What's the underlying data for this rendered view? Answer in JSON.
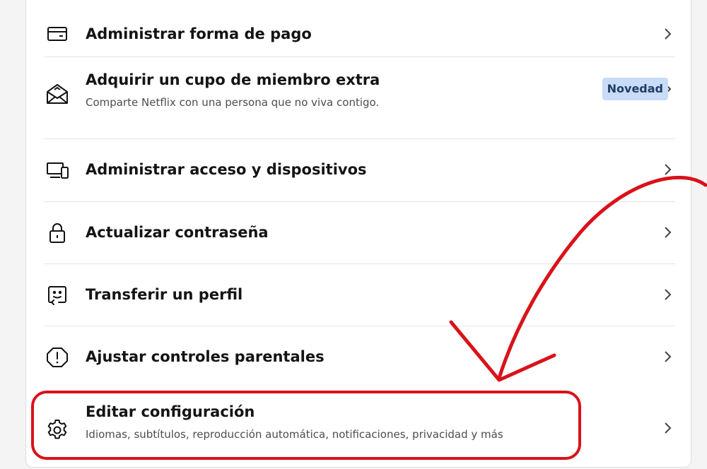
{
  "menu": {
    "payment": {
      "title": "Administrar forma de pago",
      "icon": "credit-card-icon"
    },
    "extra_member": {
      "title": "Adquirir un cupo de miembro extra",
      "subtitle": "Comparte Netflix con una persona que no viva contigo.",
      "badge": "Novedad",
      "icon": "envelope-open-icon"
    },
    "devices": {
      "title": "Administrar acceso y dispositivos",
      "icon": "devices-icon"
    },
    "password": {
      "title": "Actualizar contraseña",
      "icon": "lock-icon"
    },
    "transfer": {
      "title": "Transferir un perfil",
      "icon": "profile-transfer-icon"
    },
    "parental": {
      "title": "Ajustar controles parentales",
      "icon": "shield-alert-icon"
    },
    "settings": {
      "title": "Editar configuración",
      "subtitle": "Idiomas, subtítulos, reproducción automática, notificaciones, privacidad y más",
      "icon": "gear-icon"
    }
  },
  "colors": {
    "badge_bg": "#c8dcf8",
    "annotation_red": "#d9121a"
  }
}
